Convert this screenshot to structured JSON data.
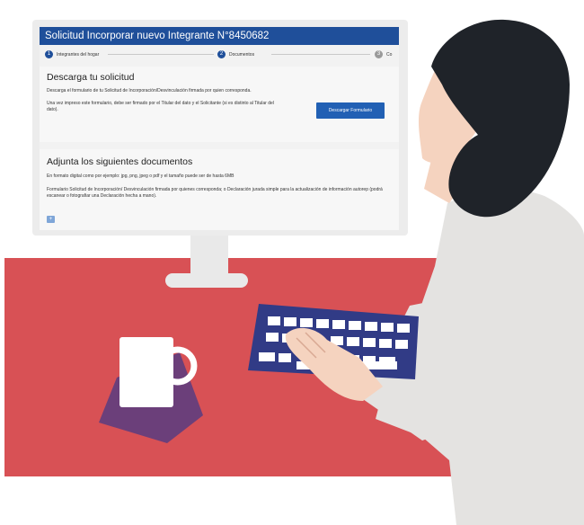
{
  "form": {
    "title": "Solicitud Incorporar nuevo Integrante N°8450682",
    "steps": [
      {
        "num": "1",
        "label": "Integrantes del hogar"
      },
      {
        "num": "2",
        "label": "Documentos"
      },
      {
        "num": "3",
        "label": "Co"
      }
    ],
    "download": {
      "title": "Descarga tu solicitud",
      "text1": "Descarga el formulario de tu Solicitud de Incorporación/Desvinculación firmada por quien corresponda.",
      "text2": "Una vez impreso este formulario, debe ser firmado por el Titular del dato y el Solicitante (si es distinto al Titular del dato).",
      "button": "Descargar Formulario"
    },
    "attach": {
      "title": "Adjunta los siguientes documentos",
      "text1": "En formato digital como por ejemplo: jpg, png, jpeg o pdf y el tamaño puede ser de hasta 6MB",
      "text2": "Formulario Solicitud de Incorporación/ Desvinculación firmada por quienes corresponda; o Declaración jurada simple para la actualización de información autorep (podrá escanear o fotografiar una Declaración hecha a mano).",
      "icon": "upload-icon"
    }
  },
  "colors": {
    "header_blue": "#1f4f9a",
    "button_blue": "#2160b4",
    "desk_red": "#d85155",
    "keyboard_navy": "#313b86",
    "coaster_purple": "#6b3f7a",
    "hair": "#1f2329",
    "skin": "#f5d3bf",
    "sweater": "#e4e3e1"
  }
}
